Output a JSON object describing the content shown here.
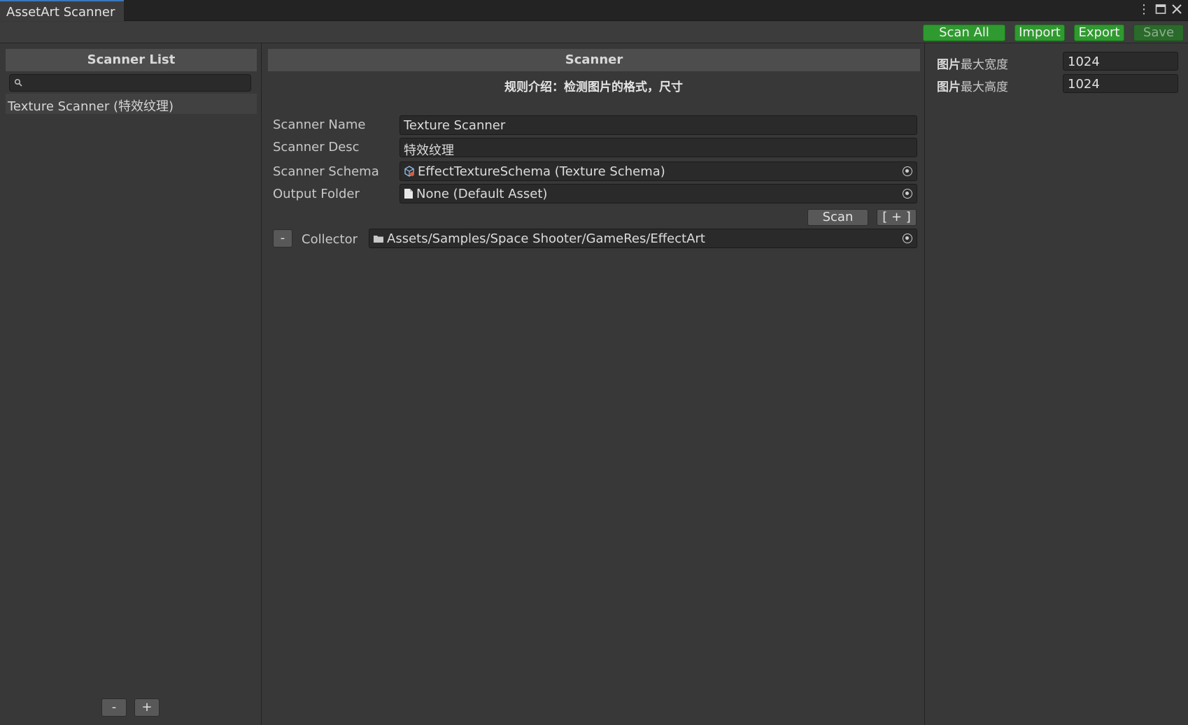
{
  "window": {
    "tab_title": "AssetArt Scanner",
    "controls": [
      "more-vert-icon",
      "maximize-icon",
      "close-icon"
    ]
  },
  "toolbar": {
    "scan_all": "Scan All",
    "import": "Import",
    "export": "Export",
    "save": "Save"
  },
  "left": {
    "title": "Scanner List",
    "search_value": "",
    "items": [
      {
        "label": "Texture Scanner (特效纹理)"
      }
    ],
    "remove_label": "-",
    "add_label": "+"
  },
  "center": {
    "title": "Scanner",
    "rule_text": "规则介绍：检测图片的格式，尺寸",
    "scanner_name": {
      "label": "Scanner Name",
      "value": "Texture Scanner"
    },
    "scanner_desc": {
      "label": "Scanner Desc",
      "value": "特效纹理"
    },
    "scanner_schema": {
      "label": "Scanner Schema",
      "value": "EffectTextureSchema (Texture Schema)"
    },
    "output_folder": {
      "label": "Output Folder",
      "value": "None (Default Asset)"
    },
    "scan_label": "Scan",
    "add_collector_label": "[ + ]",
    "collector": {
      "remove_label": "-",
      "label": "Collector",
      "value": "Assets/Samples/Space Shooter/GameRes/EffectArt"
    }
  },
  "right": {
    "max_width": {
      "label_bold": "图片",
      "label_rest": "最大宽度",
      "value": "1024"
    },
    "max_height": {
      "label_bold": "图片",
      "label_rest": "最大高度",
      "value": "1024"
    }
  },
  "colors": {
    "accent_green": "#2f9a2f",
    "tab_highlight": "#3a79bb",
    "panel_bg": "#383838",
    "field_bg": "#2a2a2a"
  }
}
